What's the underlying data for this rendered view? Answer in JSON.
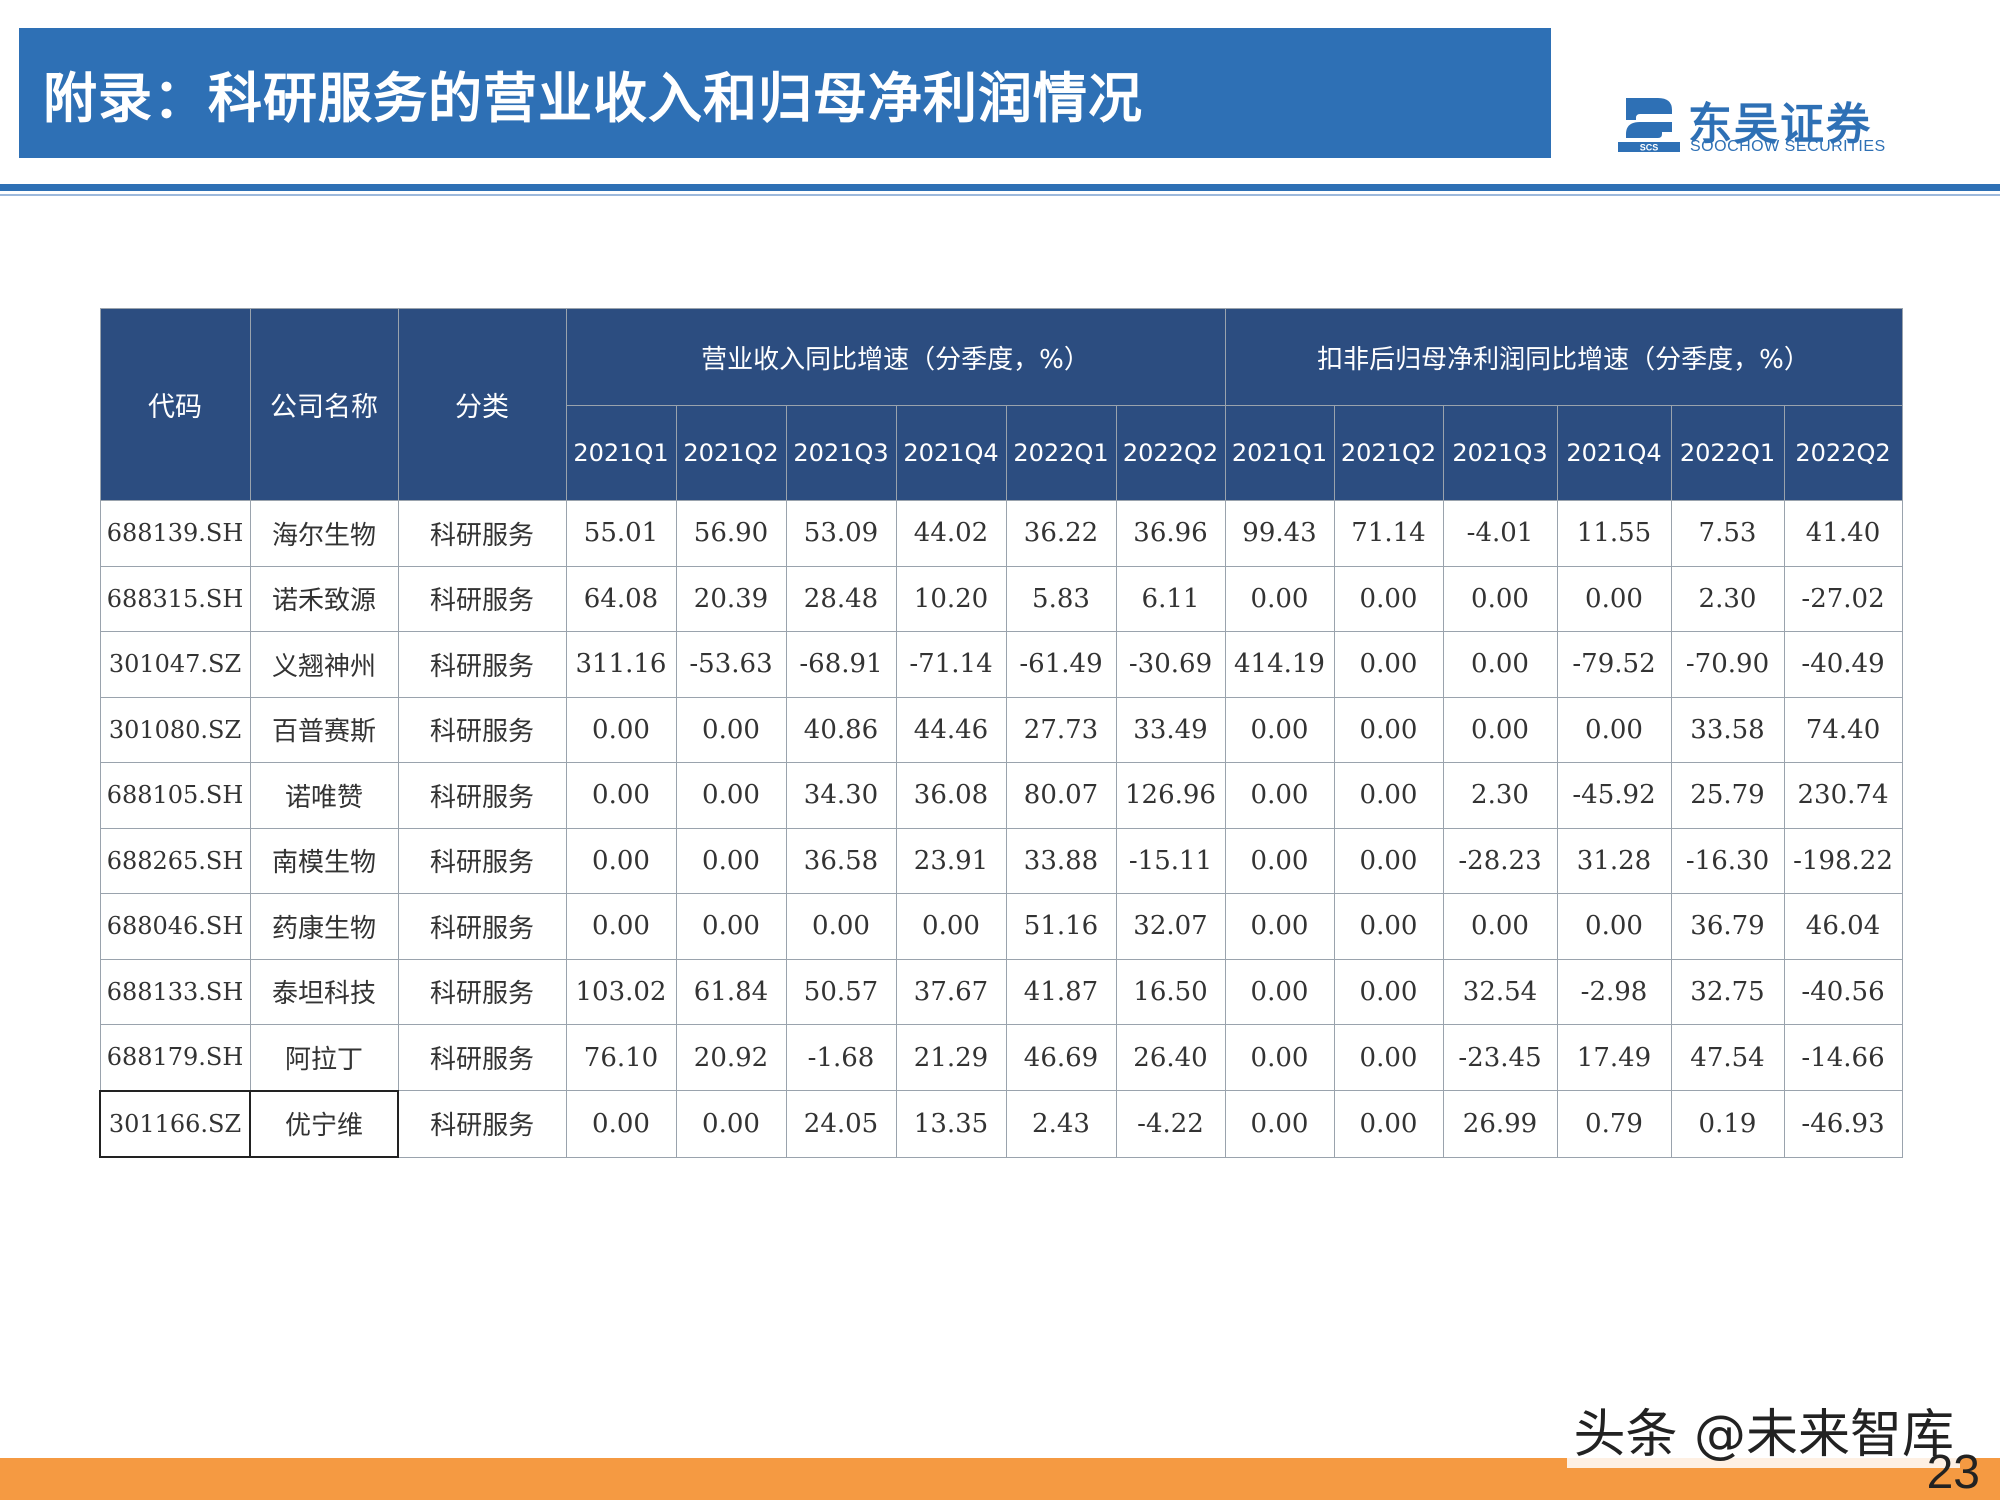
{
  "header": {
    "title": "附录：科研服务的营业收入和归母净利润情况",
    "brand_color": "#2e70b5"
  },
  "logo": {
    "cn": "东吴证券",
    "en": "SOOCHOW SECURITIES",
    "mark_text": "SCS"
  },
  "table": {
    "col_code": "代码",
    "col_name": "公司名称",
    "col_category": "分类",
    "group_revenue": "营业收入同比增速（分季度，%）",
    "group_profit": "扣非后归母净利润同比增速（分季度，%）",
    "quarters": [
      "2021Q1",
      "2021Q2",
      "2021Q3",
      "2021Q4",
      "2022Q1",
      "2022Q2"
    ],
    "rows": [
      {
        "code": "688139.SH",
        "name": "海尔生物",
        "category": "科研服务",
        "revenue": [
          "55.01",
          "56.90",
          "53.09",
          "44.02",
          "36.22",
          "36.96"
        ],
        "profit": [
          "99.43",
          "71.14",
          "-4.01",
          "11.55",
          "7.53",
          "41.40"
        ]
      },
      {
        "code": "688315.SH",
        "name": "诺禾致源",
        "category": "科研服务",
        "revenue": [
          "64.08",
          "20.39",
          "28.48",
          "10.20",
          "5.83",
          "6.11"
        ],
        "profit": [
          "0.00",
          "0.00",
          "0.00",
          "0.00",
          "2.30",
          "-27.02"
        ]
      },
      {
        "code": "301047.SZ",
        "name": "义翘神州",
        "category": "科研服务",
        "revenue": [
          "311.16",
          "-53.63",
          "-68.91",
          "-71.14",
          "-61.49",
          "-30.69"
        ],
        "profit": [
          "414.19",
          "0.00",
          "0.00",
          "-79.52",
          "-70.90",
          "-40.49"
        ]
      },
      {
        "code": "301080.SZ",
        "name": "百普赛斯",
        "category": "科研服务",
        "revenue": [
          "0.00",
          "0.00",
          "40.86",
          "44.46",
          "27.73",
          "33.49"
        ],
        "profit": [
          "0.00",
          "0.00",
          "0.00",
          "0.00",
          "33.58",
          "74.40"
        ]
      },
      {
        "code": "688105.SH",
        "name": "诺唯赞",
        "category": "科研服务",
        "revenue": [
          "0.00",
          "0.00",
          "34.30",
          "36.08",
          "80.07",
          "126.96"
        ],
        "profit": [
          "0.00",
          "0.00",
          "2.30",
          "-45.92",
          "25.79",
          "230.74"
        ]
      },
      {
        "code": "688265.SH",
        "name": "南模生物",
        "category": "科研服务",
        "revenue": [
          "0.00",
          "0.00",
          "36.58",
          "23.91",
          "33.88",
          "-15.11"
        ],
        "profit": [
          "0.00",
          "0.00",
          "-28.23",
          "31.28",
          "-16.30",
          "-198.22"
        ]
      },
      {
        "code": "688046.SH",
        "name": "药康生物",
        "category": "科研服务",
        "revenue": [
          "0.00",
          "0.00",
          "0.00",
          "0.00",
          "51.16",
          "32.07"
        ],
        "profit": [
          "0.00",
          "0.00",
          "0.00",
          "0.00",
          "36.79",
          "46.04"
        ]
      },
      {
        "code": "688133.SH",
        "name": "泰坦科技",
        "category": "科研服务",
        "revenue": [
          "103.02",
          "61.84",
          "50.57",
          "37.67",
          "41.87",
          "16.50"
        ],
        "profit": [
          "0.00",
          "0.00",
          "32.54",
          "-2.98",
          "32.75",
          "-40.56"
        ]
      },
      {
        "code": "688179.SH",
        "name": "阿拉丁",
        "category": "科研服务",
        "revenue": [
          "76.10",
          "20.92",
          "-1.68",
          "21.29",
          "46.69",
          "26.40"
        ],
        "profit": [
          "0.00",
          "0.00",
          "-23.45",
          "17.49",
          "47.54",
          "-14.66"
        ]
      },
      {
        "code": "301166.SZ",
        "name": "优宁维",
        "category": "科研服务",
        "revenue": [
          "0.00",
          "0.00",
          "24.05",
          "13.35",
          "2.43",
          "-4.22"
        ],
        "profit": [
          "0.00",
          "0.00",
          "26.99",
          "0.79",
          "0.19",
          "-46.93"
        ]
      }
    ]
  },
  "footer": {
    "watermark": "头条 @未来智库",
    "page_number": "23",
    "accent_color": "#f59a42"
  }
}
